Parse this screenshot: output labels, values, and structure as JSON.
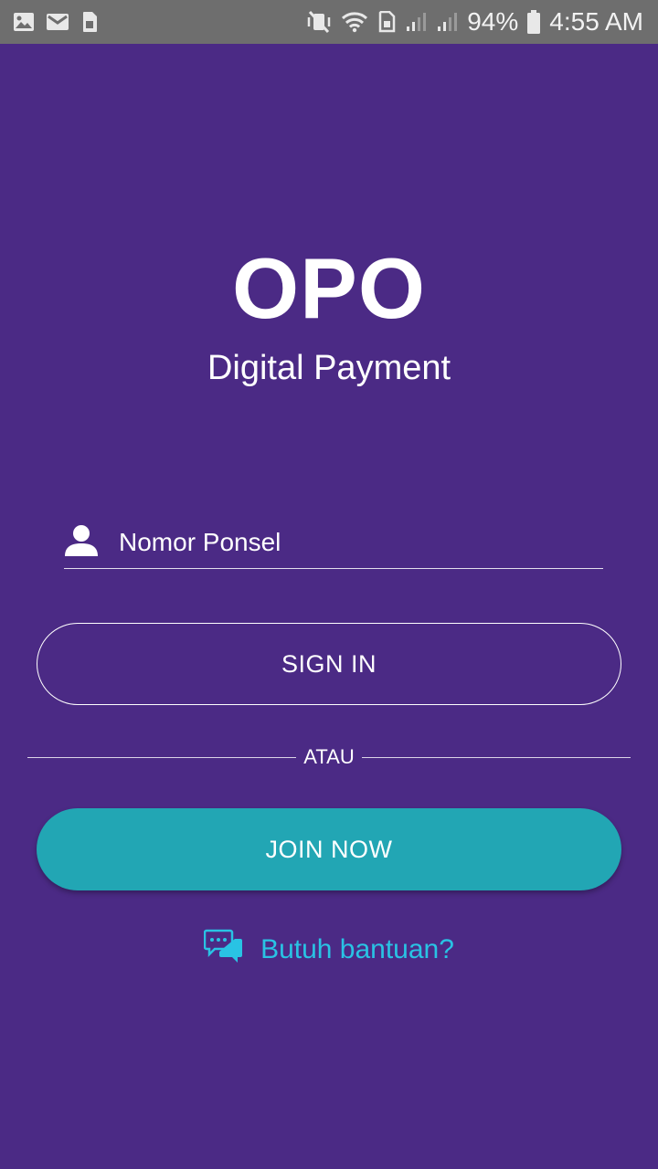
{
  "status_bar": {
    "battery": "94%",
    "time": "4:55 AM",
    "icons_left": [
      "gallery-icon",
      "gmail-icon",
      "sim-icon"
    ],
    "icons_right": [
      "vibrate-off-icon",
      "wifi-icon",
      "sim-card-icon",
      "signal-1-icon",
      "signal-2-icon",
      "battery-icon"
    ]
  },
  "brand": {
    "logo": "OPO",
    "tagline": "Digital Payment"
  },
  "login": {
    "phone_placeholder": "Nomor Ponsel",
    "signin_label": "SIGN IN",
    "divider_text": "ATAU",
    "join_label": "JOIN NOW",
    "help_label": "Butuh bantuan?"
  },
  "colors": {
    "background": "#4b2a85",
    "join_button": "#22a6b4",
    "help_text": "#29c3e4",
    "status_bar": "#6e6e6e"
  }
}
